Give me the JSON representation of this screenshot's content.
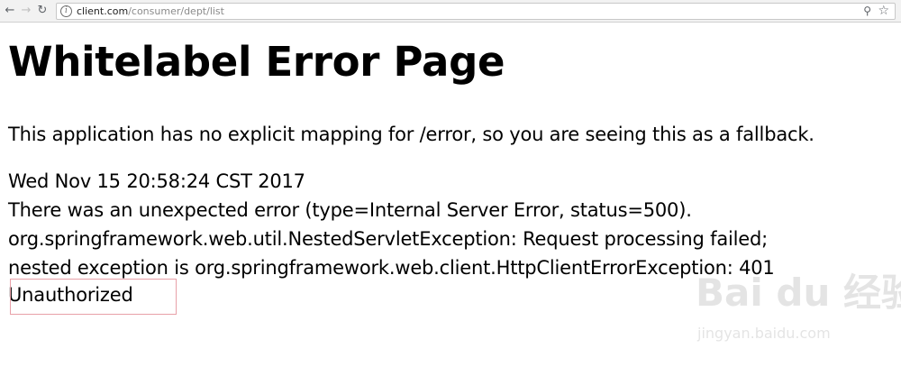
{
  "browser": {
    "back_icon": "arrow-left-icon",
    "forward_icon": "arrow-right-icon",
    "reload_icon": "reload-icon",
    "url_host": "client.com",
    "url_path": "/consumer/dept/list",
    "zoom_icon": "zoom-icon",
    "bookmark_icon": "star-icon"
  },
  "page": {
    "title": "Whitelabel Error Page",
    "fallback_message": "This application has no explicit mapping for /error, so you are seeing this as a fallback.",
    "timestamp": "Wed Nov 15 20:58:24 CST 2017",
    "error_line": "There was an unexpected error (type=Internal Server Error, status=500).",
    "exception_line1": "org.springframework.web.util.NestedServletException: Request processing failed;",
    "exception_line2": "nested exception is org.springframework.web.client.HttpClientErrorException: 401",
    "exception_line3": "Unauthorized"
  },
  "watermark": {
    "logo": "Bai du 经验",
    "sub": "jingyan.baidu.com"
  },
  "colors": {
    "highlight_border": "#e8a0a8",
    "text": "#000000"
  }
}
